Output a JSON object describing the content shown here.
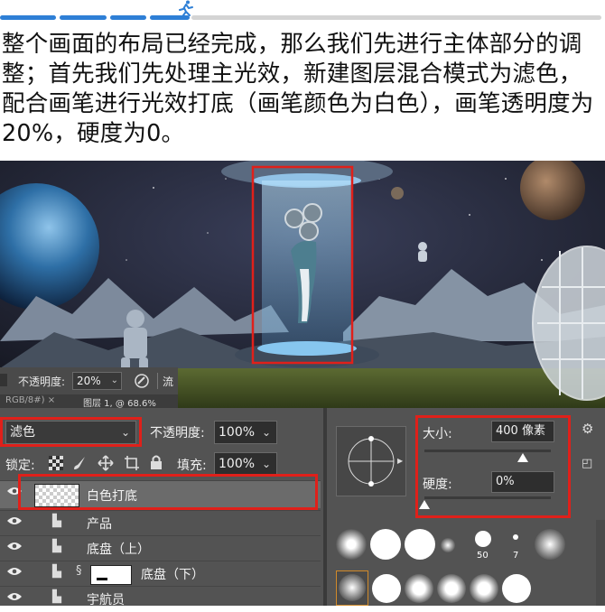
{
  "progress": {
    "filled_fraction": 0.31
  },
  "instruction_text": "整个画面的布局已经完成，那么我们先进行主体部分的调整；首先我们先处理主光效，新建图层混合模式为滤色，配合画笔进行光效打底（画笔颜色为白色），画笔透明度为20%，硬度为0。",
  "options_bar": {
    "opacity_label": "不透明度:",
    "opacity_value": "20%",
    "flow_label": "流"
  },
  "doc_tabs": {
    "tab1": "RGB/8#) ×",
    "tab2": "图层 1, @ 68.6%"
  },
  "layers_panel": {
    "blend_mode": "滤色",
    "opacity_label": "不透明度:",
    "opacity_value": "100%",
    "lock_label": "锁定:",
    "fill_label": "填充:",
    "fill_value": "100%",
    "layers": [
      {
        "name": "白色打底"
      },
      {
        "name": "产品"
      },
      {
        "name": "底盘（上）"
      },
      {
        "name": "底盘（下）"
      },
      {
        "name": "宇航员"
      }
    ]
  },
  "brush_panel": {
    "size_label": "大小:",
    "size_value": "400 像素",
    "hardness_label": "硬度:",
    "hardness_value": "0%",
    "size_fraction": 0.78,
    "hardness_fraction": 0.0,
    "preset_labels": [
      "50",
      "7"
    ]
  },
  "colors": {
    "accent_red": "#e0201a",
    "progress_blue": "#2e7fd6",
    "panel_bg": "#535353"
  }
}
